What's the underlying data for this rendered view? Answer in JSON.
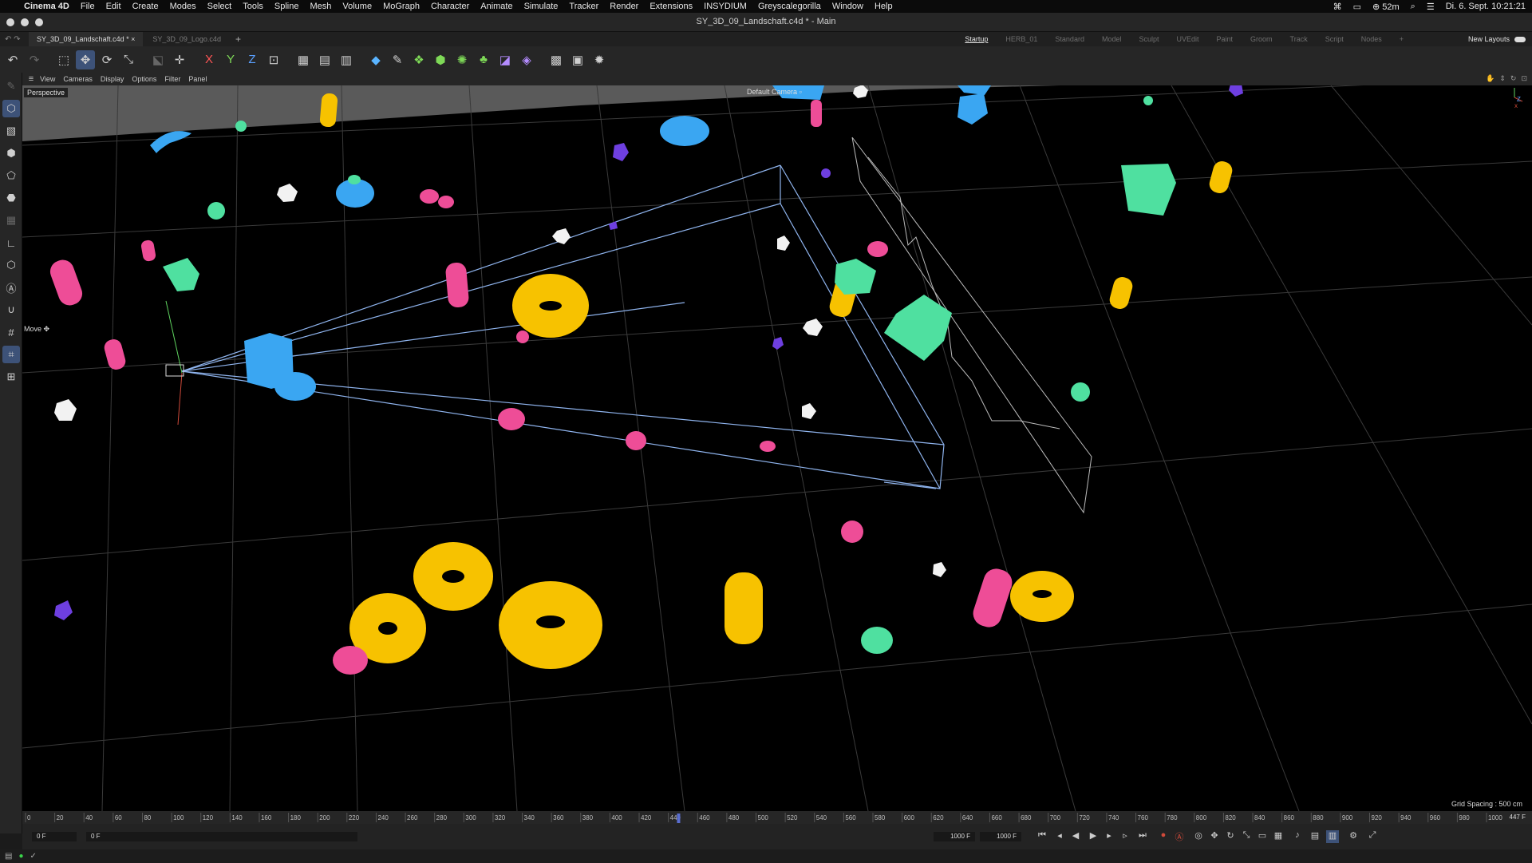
{
  "menubar": {
    "app_name": "Cinema 4D",
    "items": [
      "File",
      "Edit",
      "Create",
      "Modes",
      "Select",
      "Tools",
      "Spline",
      "Mesh",
      "Volume",
      "MoGraph",
      "Character",
      "Animate",
      "Simulate",
      "Tracker",
      "Render",
      "Extensions",
      "INSYDIUM",
      "Greyscalegorilla",
      "Window",
      "Help"
    ],
    "battery": "52m",
    "clock": "Di. 6. Sept.  10:21:21"
  },
  "window": {
    "title": "SY_3D_09_Landschaft.c4d * - Main"
  },
  "doc_tabs": [
    {
      "label": "SY_3D_09_Landschaft.c4d *",
      "active": true
    },
    {
      "label": "SY_3D_09_Logo.c4d",
      "active": false
    }
  ],
  "layouts": {
    "items": [
      "Startup",
      "HERB_01",
      "Standard",
      "Model",
      "Sculpt",
      "UVEdit",
      "Paint",
      "Groom",
      "Track",
      "Script",
      "Nodes"
    ],
    "active": "Startup",
    "new_layouts": "New Layouts"
  },
  "viewport_menu": [
    "View",
    "Cameras",
    "Display",
    "Options",
    "Filter",
    "Panel"
  ],
  "viewport": {
    "projection": "Perspective",
    "camera": "Default Camera",
    "tool": "Move",
    "grid_spacing": "Grid Spacing : 500 cm"
  },
  "timeline": {
    "ticks": [
      "0",
      "20",
      "40",
      "60",
      "80",
      "100",
      "120",
      "140",
      "160",
      "180",
      "200",
      "220",
      "240",
      "260",
      "280",
      "300",
      "320",
      "340",
      "360",
      "380",
      "400",
      "420",
      "440",
      "460",
      "480",
      "500",
      "520",
      "540",
      "560",
      "580",
      "600",
      "620",
      "640",
      "660",
      "680",
      "700",
      "720",
      "740",
      "760",
      "780",
      "800",
      "820",
      "840",
      "860",
      "880",
      "900",
      "920",
      "940",
      "960",
      "980",
      "1000"
    ],
    "current_frame": "447",
    "end_label": "447 F"
  },
  "transport": {
    "start": "0 F",
    "preview_start": "0 F",
    "preview_end": "1000 F",
    "end": "1000 F"
  },
  "colors": {
    "yellow": "#f7c200",
    "pink": "#ee4d97",
    "blue": "#3aa6f2",
    "green": "#4fe0a0",
    "purple": "#6e3fe0",
    "white": "#f2f2f2",
    "selection": "#3d5278"
  }
}
